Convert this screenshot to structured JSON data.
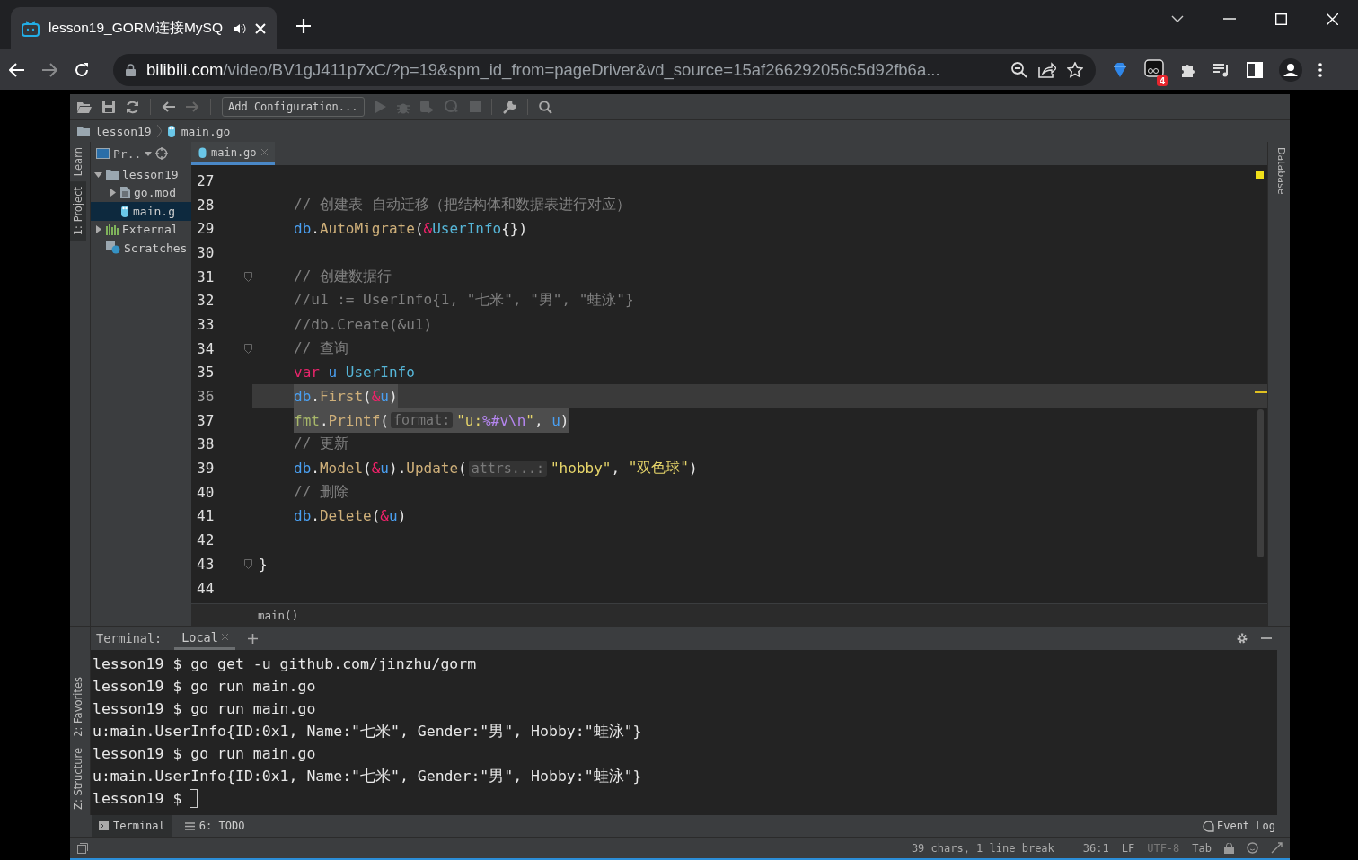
{
  "browser": {
    "tab": {
      "title": "lesson19_GORM连接MySQ"
    },
    "address": {
      "host": "bilibili.com",
      "path": "/video/BV1gJ411p7xC/?p=19&spm_id_from=pageDriver&vd_source=15af266292056c5d92fb6a..."
    },
    "extension_badge": "4"
  },
  "ide": {
    "toolbar": {
      "config_button": "Add Configuration..."
    },
    "breadcrumb": [
      "lesson19",
      "main.go"
    ],
    "left_tools": [
      {
        "label": "Learn",
        "selected": false
      },
      {
        "label": "1: Project",
        "selected": true
      }
    ],
    "left_tools_bottom": [
      {
        "label": "2: Favorites",
        "selected": false
      },
      {
        "label": "Z: Structure",
        "selected": false
      }
    ],
    "project": {
      "title": "Pr..",
      "tree": [
        {
          "label": "lesson19",
          "kind": "folder",
          "expanded": true,
          "selected": false,
          "children": [
            {
              "label": "go.mod",
              "kind": "file",
              "expanded": false,
              "selected": false
            },
            {
              "label": "main.g",
              "kind": "gofile",
              "selected": true
            }
          ]
        },
        {
          "label": "External",
          "kind": "library",
          "expanded": false,
          "selected": false
        },
        {
          "label": "Scratches",
          "kind": "scratch",
          "selected": false
        }
      ]
    },
    "editor_tabs": [
      {
        "label": "main.go",
        "selected": true
      }
    ],
    "lines": [
      {
        "number": "27",
        "current": false,
        "fold": false
      },
      {
        "number": "28",
        "selected": false,
        "current": false,
        "fold": false,
        "indented": true,
        "tokens": [
          {
            "kind": "comment",
            "text": "// 创建表 自动迁移（把结构体和数据表进行对应）"
          }
        ]
      },
      {
        "number": "29",
        "selected": false,
        "current": false,
        "fold": false,
        "indented": true,
        "tokens": [
          {
            "kind": "pkg",
            "text": "db"
          },
          {
            "kind": "punct",
            "text": "."
          },
          {
            "kind": "fn",
            "text": "AutoMigrate"
          },
          {
            "kind": "punct",
            "text": "("
          },
          {
            "kind": "amp",
            "text": "&"
          },
          {
            "kind": "type",
            "text": "UserInfo"
          },
          {
            "kind": "punct",
            "text": "{})"
          }
        ]
      },
      {
        "number": "30",
        "current": false,
        "fold": false
      },
      {
        "number": "31",
        "selected": false,
        "current": false,
        "fold": true,
        "indented": true,
        "tokens": [
          {
            "kind": "comment",
            "text": "// 创建数据行"
          }
        ]
      },
      {
        "number": "32",
        "selected": false,
        "current": false,
        "fold": false,
        "indented": true,
        "tokens": [
          {
            "kind": "comment",
            "text": "//u1 := UserInfo{1, \"七米\", \"男\", \"蛙泳\"}"
          }
        ]
      },
      {
        "number": "33",
        "selected": false,
        "current": false,
        "fold": false,
        "indented": true,
        "tokens": [
          {
            "kind": "comment",
            "text": "//db.Create(&u1)"
          }
        ]
      },
      {
        "number": "34",
        "selected": false,
        "current": false,
        "fold": true,
        "indented": true,
        "tokens": [
          {
            "kind": "comment",
            "text": "// 查询"
          }
        ]
      },
      {
        "number": "35",
        "selected": false,
        "current": false,
        "fold": false,
        "indented": true,
        "tokens": [
          {
            "kind": "keyword",
            "text": "var"
          },
          {
            "kind": "var",
            "text": "u",
            "gap": true
          },
          {
            "kind": "type",
            "text": "UserInfo",
            "gap": true
          }
        ]
      },
      {
        "number": "36",
        "selected": true,
        "current": true,
        "fold": false,
        "indented": true,
        "tokens": [
          {
            "kind": "pkg",
            "text": "db"
          },
          {
            "kind": "punct",
            "text": "."
          },
          {
            "kind": "fn",
            "text": "First"
          },
          {
            "kind": "punct",
            "text": "("
          },
          {
            "kind": "amp",
            "text": "&"
          },
          {
            "kind": "var",
            "text": "u"
          },
          {
            "kind": "punct",
            "text": ")"
          }
        ]
      },
      {
        "number": "37",
        "selected": true,
        "current": false,
        "fold": false,
        "indented": true,
        "tokens": [
          {
            "kind": "fmtpkg",
            "text": "fmt"
          },
          {
            "kind": "punct",
            "text": "."
          },
          {
            "kind": "fn",
            "text": "Printf"
          },
          {
            "kind": "punct",
            "text": "("
          },
          {
            "kind": "hint",
            "text": "format:"
          },
          {
            "kind": "string",
            "text": "\"u:"
          },
          {
            "kind": "escape",
            "text": "%#v\\n"
          },
          {
            "kind": "string",
            "text": "\""
          },
          {
            "kind": "punct",
            "text": ", "
          },
          {
            "kind": "var",
            "text": "u"
          },
          {
            "kind": "punct",
            "text": ")"
          }
        ]
      },
      {
        "number": "38",
        "selected": false,
        "current": false,
        "fold": false,
        "indented": true,
        "tokens": [
          {
            "kind": "comment",
            "text": "// 更新"
          }
        ]
      },
      {
        "number": "39",
        "selected": false,
        "current": false,
        "fold": false,
        "indented": true,
        "tokens": [
          {
            "kind": "pkg",
            "text": "db"
          },
          {
            "kind": "punct",
            "text": "."
          },
          {
            "kind": "fn",
            "text": "Model"
          },
          {
            "kind": "punct",
            "text": "("
          },
          {
            "kind": "amp",
            "text": "&"
          },
          {
            "kind": "var",
            "text": "u"
          },
          {
            "kind": "punct",
            "text": ")."
          },
          {
            "kind": "fn",
            "text": "Update"
          },
          {
            "kind": "punct",
            "text": "("
          },
          {
            "kind": "hint",
            "text": "attrs...:"
          },
          {
            "kind": "string",
            "text": "\"hobby\""
          },
          {
            "kind": "punct",
            "text": ", "
          },
          {
            "kind": "string",
            "text": "\"双色球\""
          },
          {
            "kind": "punct",
            "text": ")"
          }
        ]
      },
      {
        "number": "40",
        "selected": false,
        "current": false,
        "fold": false,
        "indented": true,
        "tokens": [
          {
            "kind": "comment",
            "text": "// 删除"
          }
        ]
      },
      {
        "number": "41",
        "selected": false,
        "current": false,
        "fold": false,
        "indented": true,
        "tokens": [
          {
            "kind": "pkg",
            "text": "db"
          },
          {
            "kind": "punct",
            "text": "."
          },
          {
            "kind": "fn",
            "text": "Delete"
          },
          {
            "kind": "punct",
            "text": "("
          },
          {
            "kind": "amp",
            "text": "&"
          },
          {
            "kind": "var",
            "text": "u"
          },
          {
            "kind": "punct",
            "text": ")"
          }
        ]
      },
      {
        "number": "42",
        "current": false,
        "fold": false
      },
      {
        "number": "43",
        "selected": false,
        "current": false,
        "fold": true,
        "indented": false,
        "tokens": [
          {
            "kind": "punct",
            "text": "}"
          }
        ]
      },
      {
        "number": "44",
        "current": false,
        "fold": false
      }
    ],
    "right_tools": [
      {
        "label": "Database",
        "selected": false
      }
    ],
    "function_crumb": "main()",
    "terminal": {
      "title": "Terminal:",
      "tabs": [
        {
          "label": "Local",
          "selected": true
        }
      ],
      "lines": [
        {
          "text": "lesson19 $ go get -u github.com/jinzhu/gorm",
          "cursor": false
        },
        {
          "text": "lesson19 $ go run main.go",
          "cursor": false
        },
        {
          "text": "lesson19 $ go run main.go",
          "cursor": false
        },
        {
          "text": "u:main.UserInfo{ID:0x1, Name:\"七米\", Gender:\"男\", Hobby:\"蛙泳\"}",
          "cursor": false
        },
        {
          "text": "lesson19 $ go run main.go",
          "cursor": false
        },
        {
          "text": "u:main.UserInfo{ID:0x1, Name:\"七米\", Gender:\"男\", Hobby:\"蛙泳\"}",
          "cursor": false
        },
        {
          "text": "lesson19 $",
          "cursor": true
        }
      ]
    },
    "bottom_tools": [
      {
        "label": "Terminal",
        "selected": true
      },
      {
        "label": "6: TODO",
        "selected": false
      }
    ],
    "event_log": "Event Log",
    "status": [
      {
        "text": "39 chars, 1 line break",
        "dim": false
      },
      {
        "text": "36:1",
        "dim": false
      },
      {
        "text": "LF",
        "dim": false
      },
      {
        "text": "UTF-8",
        "dim": true
      },
      {
        "text": "Tab",
        "dim": false
      }
    ]
  }
}
